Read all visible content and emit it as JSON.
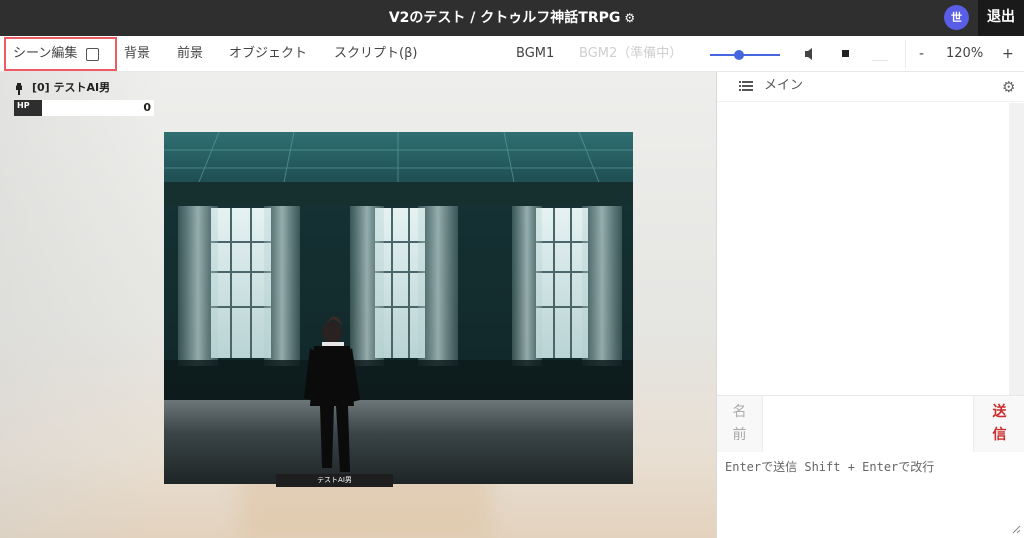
{
  "window": {
    "title": "V2のテスト / クトゥルフ神話TRPG",
    "avatar_text": "世",
    "exit_label": "退出"
  },
  "toolbar": {
    "scene_edit_label": "シーン編集",
    "background_label": "背景",
    "foreground_label": "前景",
    "object_label": "オブジェクト",
    "script_label": "スクリプト(β)",
    "bgm1_label": "BGM1",
    "bgm2_label": "BGM2（準備中）",
    "volume_level": 0.42,
    "zoom_out_label": "-",
    "zoom_value": "120%",
    "zoom_in_label": "+"
  },
  "character": {
    "name": "[0] テストAI男",
    "hp_label": "HP",
    "hp_value": "0",
    "stage_label": "テストAI男"
  },
  "chat": {
    "tab_label": "メイン",
    "name_label_1": "名",
    "name_label_2": "前",
    "send_label_1": "送",
    "send_label_2": "信",
    "message_placeholder": "Enterで送信 Shift + Enterで改行"
  },
  "colors": {
    "titlebar": "#2f2f2f",
    "highlight_border": "#ee5b63",
    "accent": "#4466e0",
    "avatar": "#5a5ee6",
    "send": "#cc2b2b"
  }
}
